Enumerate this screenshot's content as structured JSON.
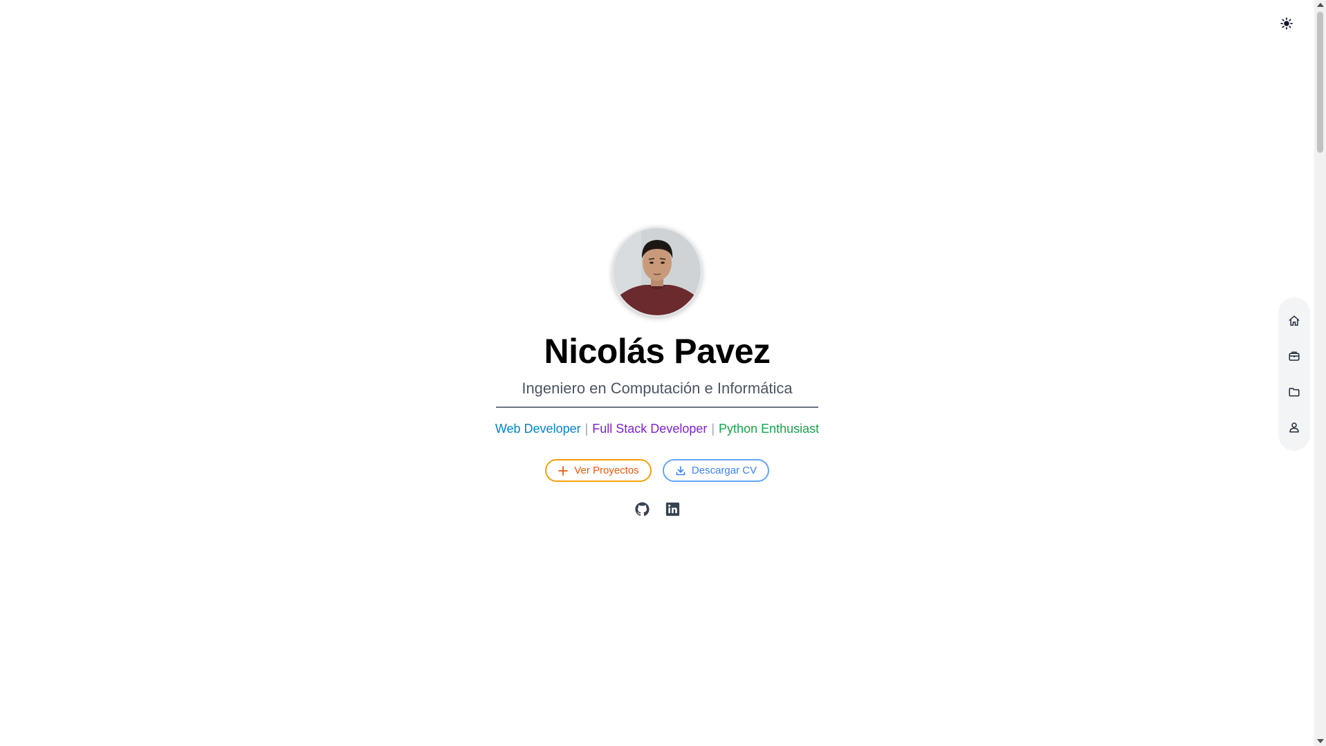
{
  "theme_toggle": {
    "icon": "sun-icon"
  },
  "hero": {
    "avatar": "profile-photo",
    "name": "Nicolás Pavez",
    "subtitle": "Ingeniero en Computación e Informática",
    "roles": [
      {
        "label": "Web Developer",
        "color": "#0284c7"
      },
      {
        "label": "Full Stack Developer",
        "color": "#7e22ce"
      },
      {
        "label": "Python Enthusiast",
        "color": "#16a34a"
      }
    ],
    "separator": "|",
    "buttons": {
      "projects": {
        "label": "Ver Proyectos",
        "icon": "plus-icon",
        "color": "#f59e0b"
      },
      "cv": {
        "label": "Descargar CV",
        "icon": "download-icon",
        "color": "#60a5fa"
      }
    },
    "socials": [
      {
        "icon": "github-icon"
      },
      {
        "icon": "linkedin-icon"
      }
    ]
  },
  "side_nav": {
    "items": [
      {
        "icon": "home-icon"
      },
      {
        "icon": "briefcase-icon"
      },
      {
        "icon": "folder-icon"
      },
      {
        "icon": "user-icon"
      }
    ]
  }
}
